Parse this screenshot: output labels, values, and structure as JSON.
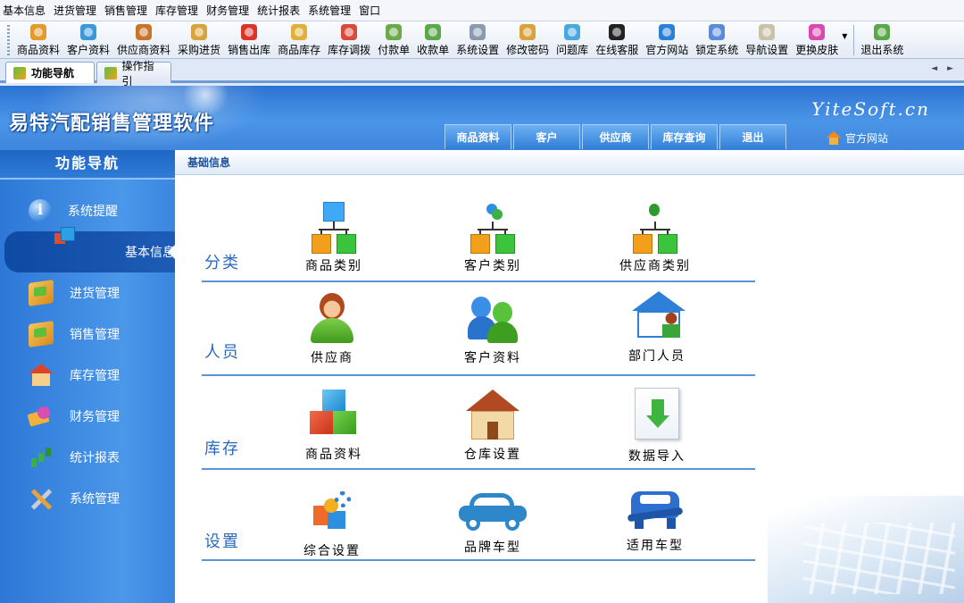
{
  "menu": [
    "基本信息",
    "进货管理",
    "销售管理",
    "库存管理",
    "财务管理",
    "统计报表",
    "系统管理",
    "窗口"
  ],
  "toolbar": [
    {
      "label": "商品资料",
      "icon": "goods-icon",
      "color": "#e39a2a"
    },
    {
      "label": "客户资料",
      "icon": "customer-icon",
      "color": "#3a9ad9"
    },
    {
      "label": "供应商资料",
      "icon": "supplier-icon",
      "color": "#c9742a"
    },
    {
      "label": "采购进货",
      "icon": "purchase-icon",
      "color": "#d9a23a"
    },
    {
      "label": "销售出库",
      "icon": "sales-icon",
      "color": "#d9342a"
    },
    {
      "label": "商品库存",
      "icon": "stock-icon",
      "color": "#e0b03a"
    },
    {
      "label": "库存调拨",
      "icon": "transfer-icon",
      "color": "#d94a3a"
    },
    {
      "label": "付款单",
      "icon": "payment-icon",
      "color": "#6aaa4a"
    },
    {
      "label": "收款单",
      "icon": "receipt-icon",
      "color": "#5aa84a"
    },
    {
      "label": "系统设置",
      "icon": "settings-icon",
      "color": "#8a9ab0"
    },
    {
      "label": "修改密码",
      "icon": "password-icon",
      "color": "#d9a23a"
    },
    {
      "label": "问题库",
      "icon": "faq-icon",
      "color": "#4aa8e0"
    },
    {
      "label": "在线客服",
      "icon": "qq-icon",
      "color": "#222222"
    },
    {
      "label": "官方网站",
      "icon": "ie-icon",
      "color": "#2a7fd8"
    },
    {
      "label": "锁定系统",
      "icon": "lock-icon",
      "color": "#5a8ad9"
    },
    {
      "label": "导航设置",
      "icon": "nav-settings-icon",
      "color": "#c9c2a8"
    },
    {
      "label": "更换皮肤",
      "icon": "skin-icon",
      "color": "#d94ab0"
    },
    {
      "label": "退出系统",
      "icon": "exit-icon",
      "color": "#5aa84a"
    }
  ],
  "tabs": [
    {
      "label": "功能导航",
      "active": true
    },
    {
      "label": "操作指引",
      "active": false
    }
  ],
  "header": {
    "title": "易特汽配销售管理软件",
    "brand": "YiteSoft.cn",
    "official_link": "官方网站",
    "nav_tabs": [
      "商品资料",
      "客户",
      "供应商",
      "库存查询",
      "退出"
    ]
  },
  "sidebar": {
    "title": "功能导航",
    "items": [
      {
        "label": "系统提醒",
        "icon": "info-icon"
      },
      {
        "label": "基本信息",
        "icon": "cubes-icon",
        "active": true
      },
      {
        "label": "进货管理",
        "icon": "box-in-icon"
      },
      {
        "label": "销售管理",
        "icon": "box-out-icon"
      },
      {
        "label": "库存管理",
        "icon": "warehouse-icon"
      },
      {
        "label": "财务管理",
        "icon": "money-icon"
      },
      {
        "label": "统计报表",
        "icon": "bar-chart-icon"
      },
      {
        "label": "系统管理",
        "icon": "tools-icon"
      }
    ]
  },
  "content": {
    "breadcrumb": "基础信息",
    "sections": [
      {
        "label": "分类",
        "items": [
          "商品类别",
          "客户类别",
          "供应商类别"
        ]
      },
      {
        "label": "人员",
        "items": [
          "供应商",
          "客户资料",
          "部门人员"
        ]
      },
      {
        "label": "库存",
        "items": [
          "商品资料",
          "仓库设置",
          "数据导入"
        ]
      },
      {
        "label": "设置",
        "items": [
          "综合设置",
          "品牌车型",
          "适用车型"
        ]
      }
    ]
  }
}
